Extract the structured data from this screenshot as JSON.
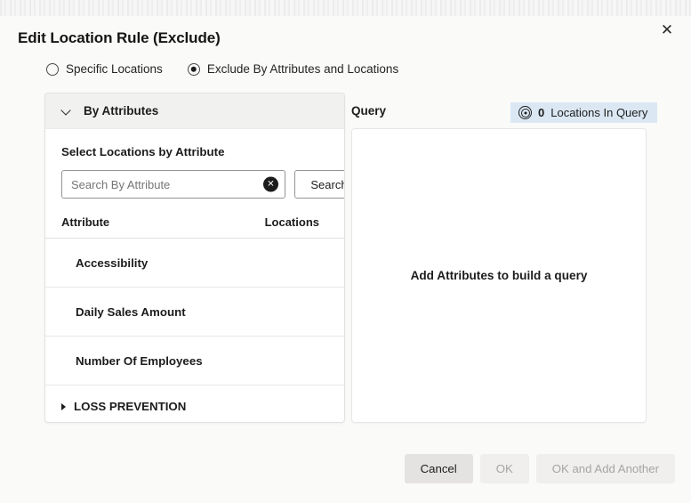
{
  "dialog": {
    "title": "Edit Location Rule (Exclude)",
    "close_icon": "close-icon"
  },
  "mode_options": [
    {
      "label": "Specific Locations",
      "selected": false
    },
    {
      "label": "Exclude By Attributes and Locations",
      "selected": true
    }
  ],
  "left_panel": {
    "accordion_title": "By Attributes",
    "accordion_icon": "chevron-down-icon",
    "section_label": "Select Locations by Attribute",
    "search": {
      "value": "",
      "placeholder": "Search By Attribute",
      "clear_icon": "clear-circle-icon",
      "button_label": "Search"
    },
    "table": {
      "columns": [
        "Attribute",
        "Locations"
      ],
      "rows": [
        {
          "attribute": "Accessibility",
          "locations": "",
          "type": "item"
        },
        {
          "attribute": "Daily Sales Amount",
          "locations": "",
          "type": "item"
        },
        {
          "attribute": "Number Of Employees",
          "locations": "",
          "type": "item"
        },
        {
          "attribute": "LOSS PREVENTION",
          "locations": "",
          "type": "group"
        }
      ]
    }
  },
  "right_panel": {
    "label": "Query",
    "badge": {
      "icon": "bullseye-icon",
      "count": "0",
      "text": "Locations In Query"
    },
    "empty_state": "Add Attributes to build a query"
  },
  "footer": {
    "cancel_label": "Cancel",
    "ok_label": "OK",
    "ok_add_another_label": "OK and Add Another"
  },
  "colors": {
    "badge_bg": "#dbe8f4",
    "accordion_bg": "#f1f1f0",
    "page_bg": "#fafaf9",
    "button_secondary": "#e4e3e1",
    "button_disabled": "#f0efed"
  }
}
